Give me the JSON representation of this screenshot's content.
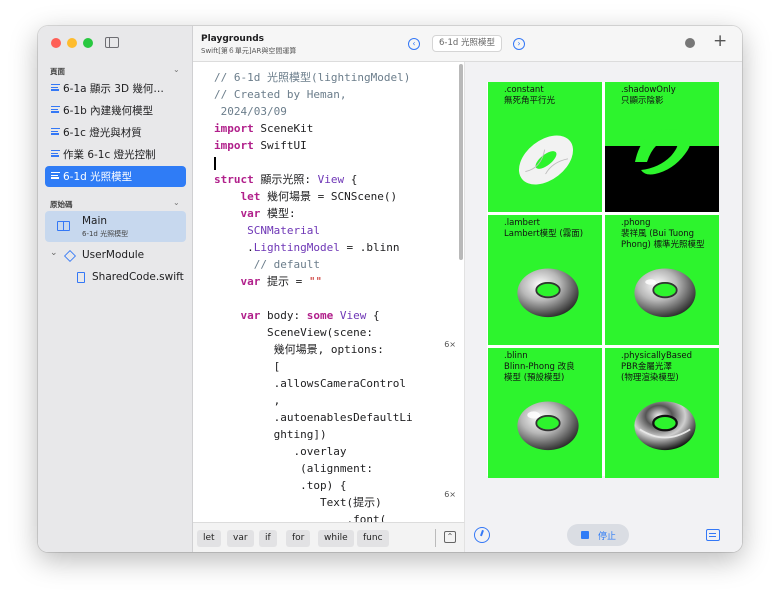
{
  "sidebar": {
    "pages_header": "頁面",
    "pages": [
      {
        "label": "6-1a 顯示 3D 幾何…"
      },
      {
        "label": "6-1b 內建幾何模型"
      },
      {
        "label": "6-1c 燈光與材質"
      },
      {
        "label": "作業 6-1c 燈光控制"
      },
      {
        "label": "6-1d 光照模型"
      }
    ],
    "source_header": "原始碼",
    "main_item": {
      "label": "Main",
      "sub": "6-1d 光照模型"
    },
    "module": {
      "label": "UserModule"
    },
    "shared_file": {
      "label": "SharedCode.swift"
    }
  },
  "titlebar": {
    "title": "Playgrounds",
    "subtitle": "Swift[第６單元]AR與空間運算",
    "current_page": "6-1d 光照模型"
  },
  "editor": {
    "counts": [
      "6×",
      "6×"
    ]
  },
  "keyboard": {
    "keys": [
      "let",
      "var",
      "if",
      "for",
      "while",
      "func"
    ]
  },
  "preview": {
    "cells": [
      {
        "name": ".constant",
        "desc": "無死角平行光"
      },
      {
        "name": ".shadowOnly",
        "desc": "只顯示陰影"
      },
      {
        "name": ".lambert",
        "desc": "Lambert模型 (霧面)"
      },
      {
        "name": ".phong",
        "desc1": "裴祥風 (Bui Tuong",
        "desc2": "Phong) 標準光照模型"
      },
      {
        "name": ".blinn",
        "desc1": "Blinn-Phong 改良",
        "desc2": "模型 (預設模型)"
      },
      {
        "name": ".physicallyBased",
        "desc1": "PBR金屬光澤",
        "desc2": "(物理渲染模型)"
      }
    ],
    "stop_label": "停止",
    "background_color": "#2df42d"
  }
}
